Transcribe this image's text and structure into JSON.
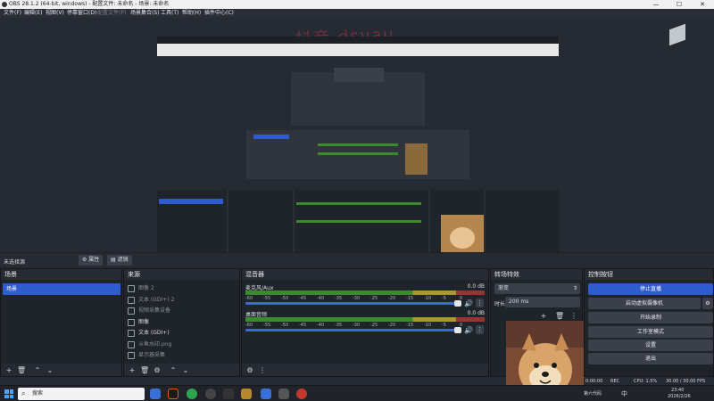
{
  "window": {
    "title": "OBS 28.1.2 (64-bit, windows) - 配置文件: 未命名 - 场景: 未命名",
    "min": "—",
    "max": "☐",
    "close": "✕"
  },
  "menu": [
    "文件(F)",
    "编辑(E)",
    "视图(V)",
    "停靠窗口(D)",
    "配置文件(P)",
    "场景集合(S)",
    "工具(T)",
    "帮助(H)",
    "插件中心(C)"
  ],
  "watermark": "抖音 dsyau",
  "context": {
    "label": "未选择源",
    "properties": "属性",
    "filters": "滤镜"
  },
  "scenes": {
    "title": "场景",
    "items": [
      "场景"
    ]
  },
  "sources": {
    "title": "来源",
    "items": [
      {
        "name": "图像 2",
        "icon": "image-icon",
        "visible": false,
        "dim": true
      },
      {
        "name": "文本 (GDI+) 2",
        "icon": "text-icon",
        "visible": false,
        "dim": true
      },
      {
        "name": "视频采集设备",
        "icon": "camera-icon",
        "visible": false,
        "dim": true
      },
      {
        "name": "图像",
        "icon": "image-icon",
        "visible": true,
        "dim": false
      },
      {
        "name": "文本 (GDI+)",
        "icon": "text-icon",
        "visible": true,
        "dim": false
      },
      {
        "name": "斗鱼水印.png",
        "icon": "image-icon",
        "visible": false,
        "dim": true
      },
      {
        "name": "显示器采集",
        "icon": "monitor-icon",
        "visible": false,
        "dim": true
      }
    ]
  },
  "mixer": {
    "title": "混音器",
    "channels": [
      {
        "name": "麦克风/Aux",
        "db": "0.0 dB"
      },
      {
        "name": "桌面音频",
        "db": "0.0 dB"
      }
    ],
    "ticks": [
      "-60",
      "-55",
      "-50",
      "-45",
      "-40",
      "-35",
      "-30",
      "-25",
      "-20",
      "-15",
      "-10",
      "-5",
      "0"
    ]
  },
  "transitions": {
    "title": "转场特效",
    "type": "渐变",
    "duration_label": "时长",
    "duration": "200 ms"
  },
  "controls": {
    "title": "控制按钮",
    "buttons": [
      "停止直播",
      "启动虚拟摄像机",
      "开始录制",
      "工作室模式",
      "设置",
      "退出"
    ]
  },
  "status": {
    "time": "0:00:00",
    "rec": "REC",
    "fps": "30.00 / 30.00 FPS",
    "cpu": "CPU: 1.5%"
  },
  "taskbar": {
    "search": "搜索",
    "weather": "第六代码",
    "clock": "23:40",
    "date": "2026/2/26",
    "lang": "中"
  }
}
